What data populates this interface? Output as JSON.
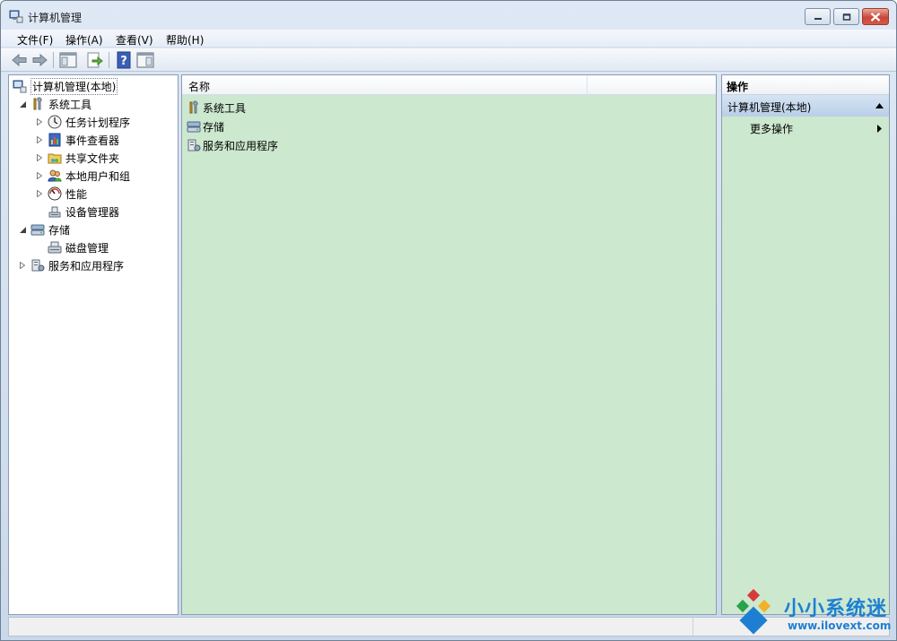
{
  "window": {
    "title": "计算机管理"
  },
  "menu": [
    "文件(F)",
    "操作(A)",
    "查看(V)",
    "帮助(H)"
  ],
  "toolbar": {
    "items": [
      "back-icon",
      "forward-icon",
      "show-hide-console-tree-icon",
      "export-list-icon",
      "help-icon",
      "show-hide-action-pane-icon"
    ]
  },
  "tree": {
    "root": "计算机管理(本地)",
    "system_tools": "系统工具",
    "task_scheduler": "任务计划程序",
    "event_viewer": "事件查看器",
    "shared_folders": "共享文件夹",
    "local_users": "本地用户和组",
    "performance": "性能",
    "device_manager": "设备管理器",
    "storage": "存储",
    "disk_management": "磁盘管理",
    "services_apps": "服务和应用程序"
  },
  "list": {
    "column_name": "名称",
    "rows": [
      "系统工具",
      "存储",
      "服务和应用程序"
    ]
  },
  "actions": {
    "title": "操作",
    "group": "计算机管理(本地)",
    "more": "更多操作"
  },
  "watermark": {
    "text": "小小系统迷",
    "url": "www.ilovext.com"
  },
  "colors": {
    "pane_green": "#cce8cf",
    "accent_blue": "#1e7fd2"
  }
}
